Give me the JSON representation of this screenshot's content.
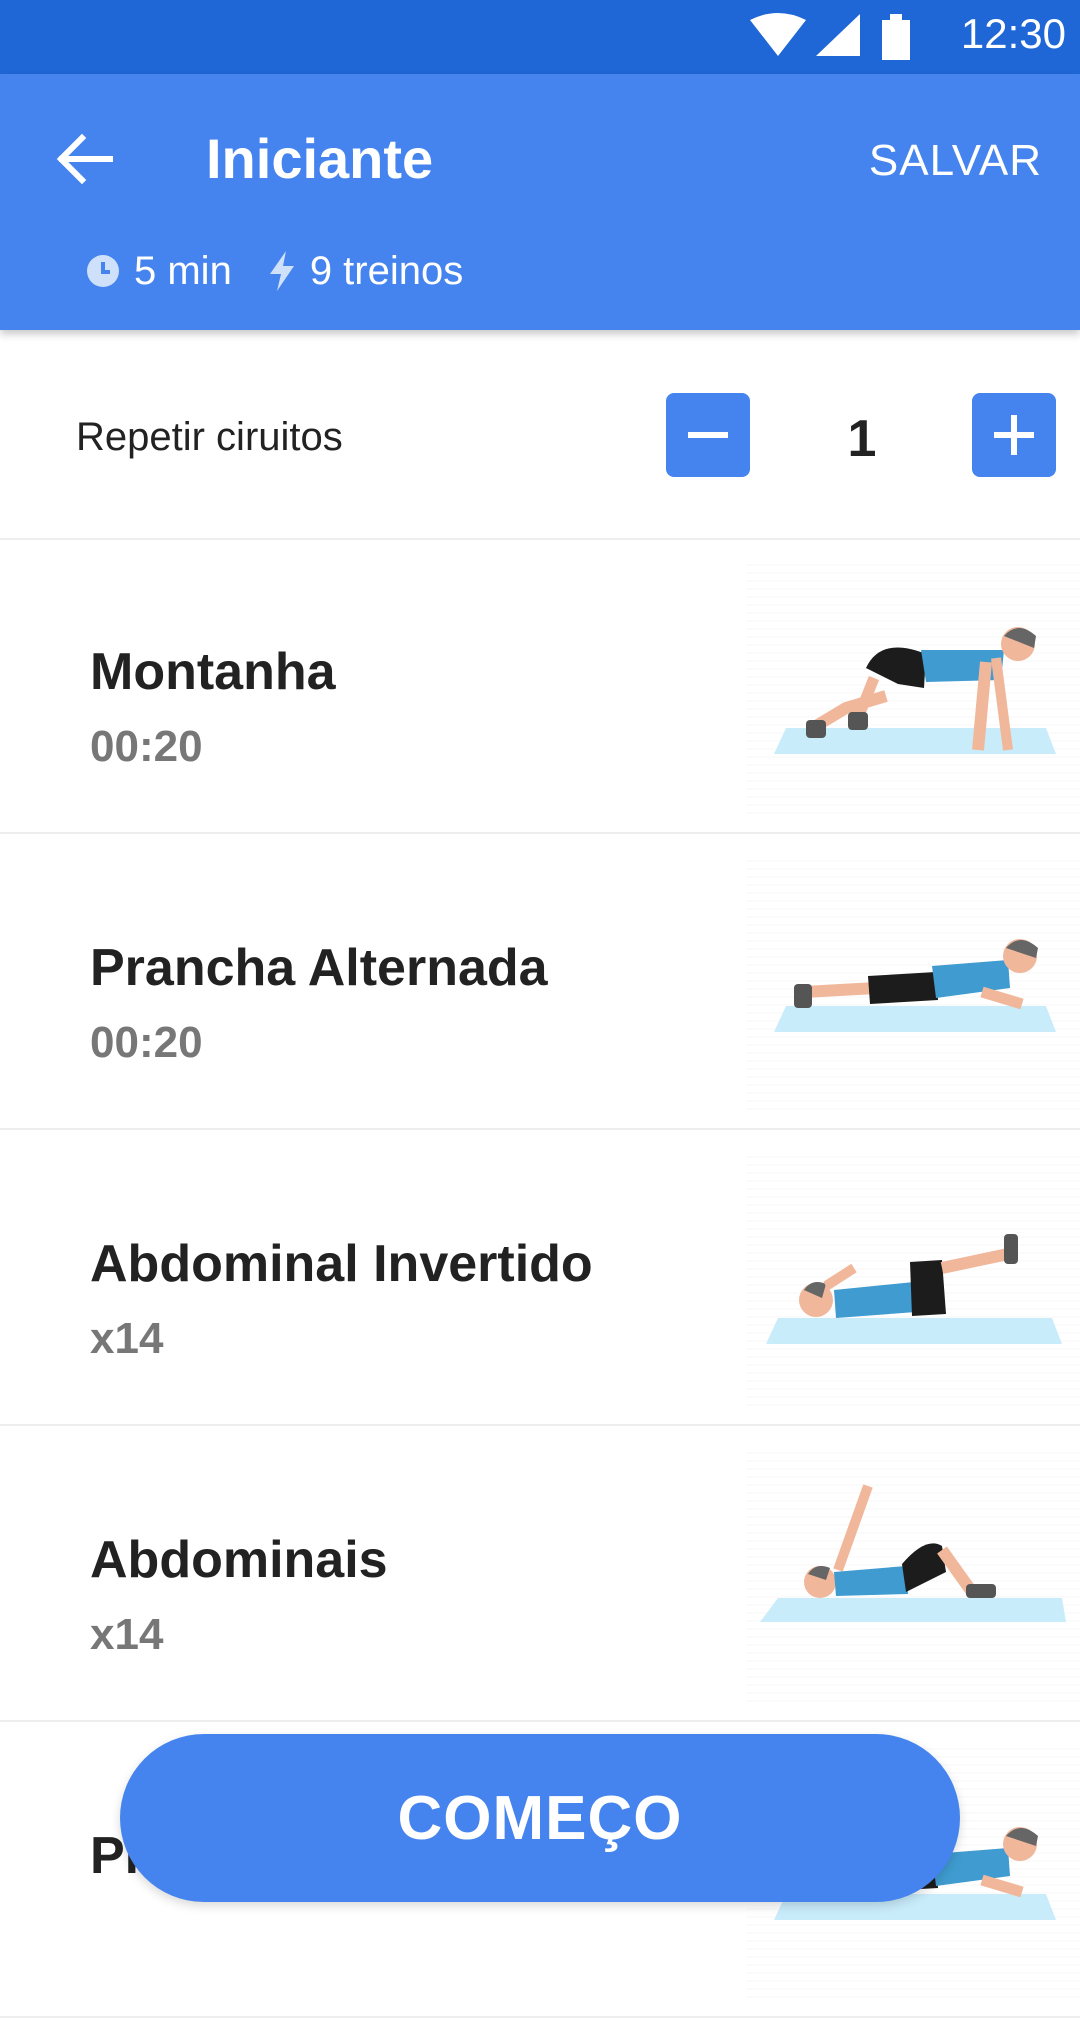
{
  "status_bar": {
    "time": "12:30"
  },
  "header": {
    "title": "Iniciante",
    "save_label": "SALVAR",
    "duration": "5 min",
    "workouts": "9 treinos"
  },
  "repeat": {
    "label": "Repetir ciruitos",
    "count": "1"
  },
  "exercises": [
    {
      "name": "Montanha",
      "value": "00:20",
      "illustration": "mountain-climber-figure"
    },
    {
      "name": "Prancha Alternada",
      "value": "00:20",
      "illustration": "plank-figure"
    },
    {
      "name": "Abdominal Invertido",
      "value": "x14",
      "illustration": "reverse-crunch-figure"
    },
    {
      "name": "Abdominais",
      "value": "x14",
      "illustration": "crunch-figure"
    },
    {
      "name": "Pr",
      "value": "",
      "illustration": "plank-figure"
    }
  ],
  "start_button": {
    "label": "COMEÇO"
  },
  "colors": {
    "status_bar": "#1f66d6",
    "primary": "#4584ee",
    "mat": "#c9ecfb",
    "shirt": "#3f9bd0",
    "shorts": "#1c1c1c",
    "skin": "#f1b79b"
  }
}
